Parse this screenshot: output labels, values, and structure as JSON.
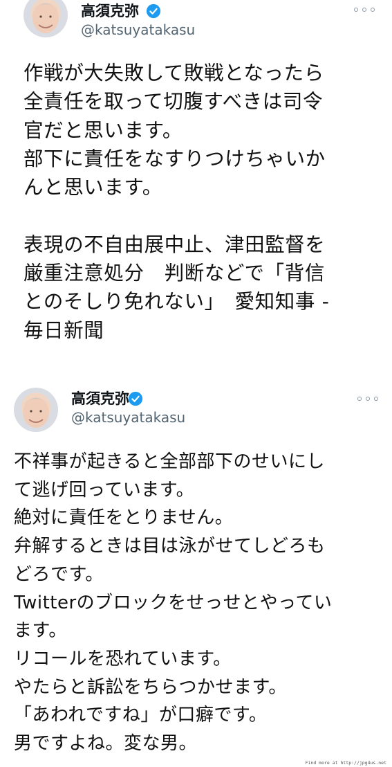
{
  "tweets": [
    {
      "author": {
        "name": "高須克弥",
        "handle": "@katsuyatakasu"
      },
      "text": "作戦が大失敗して敗戦となったら\n全責任を取って切腹すべきは司令\n官だと思います。\n部下に責任をなすりつけちゃいか\nんと思います。\n\n表現の不自由展中止、津田監督を\n厳重注意処分　判断などで「背信\nとのそしり免れない」　愛知知事 -\n毎日新聞"
    },
    {
      "author": {
        "name": "高須克弥",
        "handle": "@katsuyatakasu"
      },
      "text": "不祥事が起きると全部部下のせいにし\nて逃げ回っています。\n絶対に責任をとりません。\n弁解するときは目は泳がせてしどろも\nどろです。\nTwitterのブロックをせっせとやってい\nます。\nリコールを恐れています。\nやたらと訴訟をちらつかせます。\n「あわれですね」が口癖です。\n男ですよね。変な男。"
    }
  ],
  "watermark": "Find more at http://jpg4us.net",
  "colors": {
    "verified": "#1d9bf0",
    "handle": "#536471",
    "text": "#111111",
    "background": "#ffffff"
  },
  "icons": [
    "verified-badge-icon",
    "more-options-icon",
    "avatar"
  ]
}
